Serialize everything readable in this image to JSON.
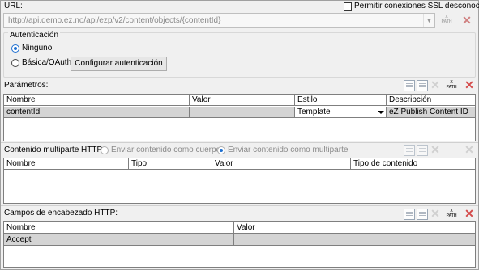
{
  "url": {
    "label": "URL:",
    "value": "http://api.demo.ez.no/api/ezp/v2/content/objects/{contentId}",
    "ssl_label": "Permitir conexiones SSL desconocidas",
    "ssl_checked": false,
    "xpath_label": "PATH"
  },
  "auth": {
    "title": "Autenticación",
    "options": [
      "Ninguno",
      "Básica/OAuth"
    ],
    "selected": "Ninguno",
    "configure_button": "Configurar autenticación"
  },
  "params": {
    "title": "Parámetros:",
    "columns": [
      "Nombre",
      "Valor",
      "Estilo",
      "Descripción"
    ],
    "rows": [
      {
        "nombre": "contentId",
        "valor": "",
        "estilo": "Template",
        "descripcion": "eZ Publish Content ID"
      }
    ]
  },
  "multipart": {
    "title": "Contenido multiparte HTTP:",
    "option_body": "Enviar contenido como cuerpo",
    "option_multipart": "Enviar contenido como multiparte",
    "selected": "Enviar contenido como multiparte",
    "columns": [
      "Nombre",
      "Tipo",
      "Valor",
      "Tipo de contenido"
    ]
  },
  "headers": {
    "title": "Campos de encabezado HTTP:",
    "columns": [
      "Nombre",
      "Valor"
    ],
    "rows": [
      {
        "nombre": "Accept",
        "valor": ""
      }
    ]
  },
  "toolbar_icons": [
    "append-row-icon",
    "insert-row-icon",
    "delete-row-icon",
    "xpath-icon",
    "clear-table-icon"
  ]
}
